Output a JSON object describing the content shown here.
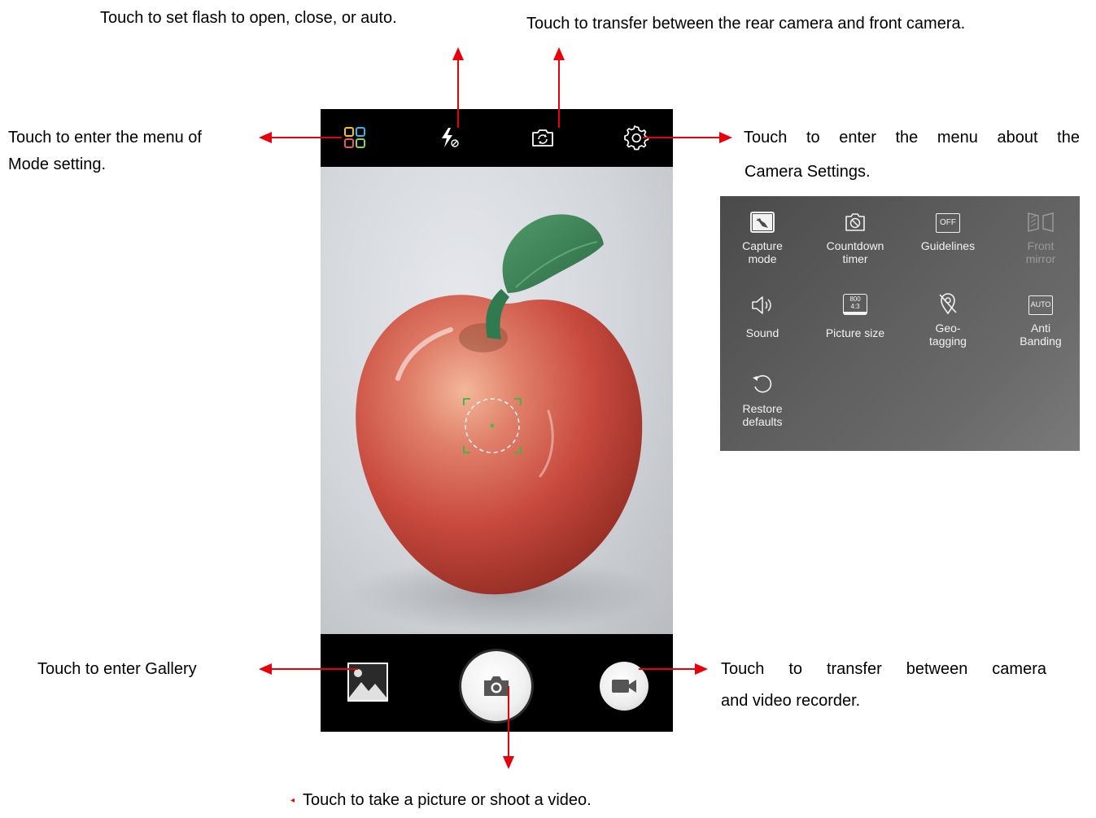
{
  "callouts": {
    "flash": "Touch to set flash to open, close, or auto.",
    "switch_camera": "Touch to transfer between the rear camera and front camera.",
    "mode_line1": "Touch to enter the menu of",
    "mode_line2": "Mode setting.",
    "settings_line1": "Touch to enter the menu about the",
    "settings_line2": "Camera Settings.",
    "gallery": "Touch to enter Gallery",
    "video_line1": "Touch to transfer between camera",
    "video_line2": "and video recorder.",
    "shutter": "Touch to take a picture or shoot a video."
  },
  "camera": {
    "top_icons": [
      "mode-grid-icon",
      "flash-off-icon",
      "switch-camera-icon",
      "gear-icon"
    ],
    "bottom_icons": [
      "gallery-icon",
      "camera-icon",
      "video-camera-icon"
    ],
    "subject": "apple-photo",
    "focus_indicator": "focus-ring-icon"
  },
  "settings_panel": {
    "items": [
      {
        "label": "Capture\nmode",
        "icon": "capture-mode-icon",
        "enabled": true
      },
      {
        "label": "Countdown\ntimer",
        "icon": "timer-off-icon",
        "enabled": true
      },
      {
        "label": "Guidelines",
        "icon": "guidelines-off-icon",
        "icon_text": "OFF",
        "enabled": true
      },
      {
        "label": "Front\nmirror",
        "icon": "front-mirror-icon",
        "enabled": false
      },
      {
        "label": "Sound",
        "icon": "sound-icon",
        "enabled": true
      },
      {
        "label": "Picture size",
        "icon": "picture-size-icon",
        "icon_text_top": "800",
        "icon_text_bottom": "4:3",
        "enabled": true
      },
      {
        "label": "Geo-\ntagging",
        "icon": "geotagging-off-icon",
        "enabled": true
      },
      {
        "label": "Anti\nBanding",
        "icon": "anti-banding-icon",
        "icon_text": "AUTO",
        "enabled": true
      },
      {
        "label": "Restore\ndefaults",
        "icon": "restore-icon",
        "enabled": true
      }
    ]
  },
  "colors": {
    "arrow": "#e8000b",
    "focus": "#2fbf3f",
    "mode_grid": [
      "#f5c400",
      "#31b7e8",
      "#e85a4f",
      "#8bd14a"
    ]
  }
}
